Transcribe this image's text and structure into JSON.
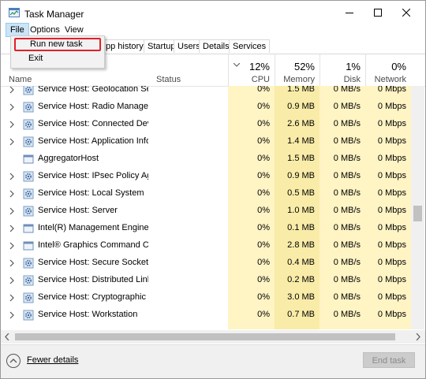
{
  "window": {
    "title": "Task Manager"
  },
  "menu": {
    "file": "File",
    "options": "Options",
    "view": "View"
  },
  "file_menu": {
    "run_new_task": "Run new task",
    "exit": "Exit"
  },
  "tabs": [
    "pp history",
    "Startup",
    "Users",
    "Details",
    "Services"
  ],
  "columns": {
    "name": "Name",
    "status": "Status",
    "cpu": {
      "pct": "12%",
      "label": "CPU"
    },
    "memory": {
      "pct": "52%",
      "label": "Memory"
    },
    "disk": {
      "pct": "1%",
      "label": "Disk"
    },
    "network": {
      "pct": "0%",
      "label": "Network"
    }
  },
  "rows": [
    {
      "name": "Service Host: Geolocation Service",
      "cpu": "0%",
      "memory": "1.5 MB",
      "disk": "0 MB/s",
      "network": "0 Mbps",
      "expandable": true,
      "icon": "gear-icon"
    },
    {
      "name": "Service Host: Radio Manageme...",
      "cpu": "0%",
      "memory": "0.9 MB",
      "disk": "0 MB/s",
      "network": "0 Mbps",
      "expandable": true,
      "icon": "gear-icon"
    },
    {
      "name": "Service Host: Connected Device...",
      "cpu": "0%",
      "memory": "2.6 MB",
      "disk": "0 MB/s",
      "network": "0 Mbps",
      "expandable": true,
      "icon": "gear-icon"
    },
    {
      "name": "Service Host: Application Infor...",
      "cpu": "0%",
      "memory": "1.4 MB",
      "disk": "0 MB/s",
      "network": "0 Mbps",
      "expandable": true,
      "icon": "gear-icon"
    },
    {
      "name": "AggregatorHost",
      "cpu": "0%",
      "memory": "1.5 MB",
      "disk": "0 MB/s",
      "network": "0 Mbps",
      "expandable": false,
      "icon": "app-window-icon"
    },
    {
      "name": "Service Host: IPsec Policy Agent",
      "cpu": "0%",
      "memory": "0.9 MB",
      "disk": "0 MB/s",
      "network": "0 Mbps",
      "expandable": true,
      "icon": "gear-icon"
    },
    {
      "name": "Service Host: Local System",
      "cpu": "0%",
      "memory": "0.5 MB",
      "disk": "0 MB/s",
      "network": "0 Mbps",
      "expandable": true,
      "icon": "gear-icon"
    },
    {
      "name": "Service Host: Server",
      "cpu": "0%",
      "memory": "1.0 MB",
      "disk": "0 MB/s",
      "network": "0 Mbps",
      "expandable": true,
      "icon": "gear-icon"
    },
    {
      "name": "Intel(R) Management Engine W...",
      "cpu": "0%",
      "memory": "0.1 MB",
      "disk": "0 MB/s",
      "network": "0 Mbps",
      "expandable": true,
      "icon": "app-window-icon"
    },
    {
      "name": "Intel® Graphics Command Cen...",
      "cpu": "0%",
      "memory": "2.8 MB",
      "disk": "0 MB/s",
      "network": "0 Mbps",
      "expandable": true,
      "icon": "app-window-icon"
    },
    {
      "name": "Service Host: Secure Socket Tun...",
      "cpu": "0%",
      "memory": "0.4 MB",
      "disk": "0 MB/s",
      "network": "0 Mbps",
      "expandable": true,
      "icon": "gear-icon"
    },
    {
      "name": "Service Host: Distributed Link Tr...",
      "cpu": "0%",
      "memory": "0.2 MB",
      "disk": "0 MB/s",
      "network": "0 Mbps",
      "expandable": true,
      "icon": "gear-icon"
    },
    {
      "name": "Service Host: Cryptographic Ser...",
      "cpu": "0%",
      "memory": "3.0 MB",
      "disk": "0 MB/s",
      "network": "0 Mbps",
      "expandable": true,
      "icon": "gear-icon"
    },
    {
      "name": "Service Host: Workstation",
      "cpu": "0%",
      "memory": "0.7 MB",
      "disk": "0 MB/s",
      "network": "0 Mbps",
      "expandable": true,
      "icon": "gear-icon"
    }
  ],
  "footer": {
    "fewer_details": "Fewer details",
    "end_task": "End task"
  },
  "colors": {
    "heat_light": "#fff4c4",
    "heat_medium": "#f9eca8",
    "menu_highlight": "#e0202a",
    "menu_active_bg": "#cce4f7"
  }
}
